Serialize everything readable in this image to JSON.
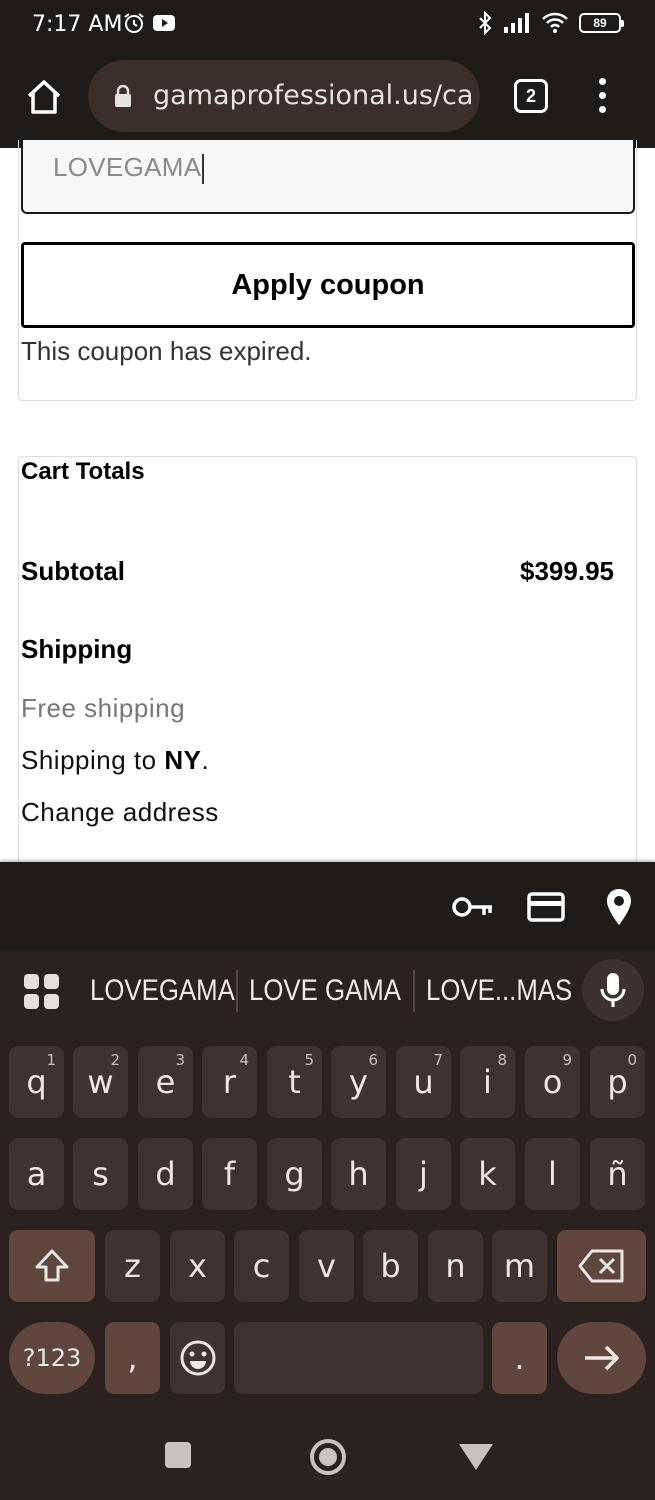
{
  "status_bar": {
    "time": "7:17 AM",
    "battery": "89",
    "icons": [
      "alarm-icon",
      "youtube-icon",
      "bluetooth-icon",
      "signal-icon",
      "wifi-icon",
      "battery-icon"
    ]
  },
  "browser": {
    "url": "gamaprofessional.us/ca",
    "tab_count": "2",
    "icons": [
      "home-icon",
      "lock-icon",
      "more-vert-icon"
    ]
  },
  "coupon": {
    "input_value": "LOVEGAMA",
    "apply_button": "Apply coupon",
    "message": "This coupon has expired."
  },
  "cart_totals": {
    "title": "Cart Totals",
    "subtotal_label": "Subtotal",
    "subtotal_value": "$399.95",
    "shipping_label": "Shipping",
    "shipping_method": "Free shipping",
    "shipping_to_prefix": "Shipping to ",
    "shipping_state": "NY",
    "shipping_to_suffix": ".",
    "change_address": "Change address"
  },
  "keyboard": {
    "autofill_icons": [
      "key-icon",
      "credit-card-icon",
      "location-pin-icon"
    ],
    "suggestions": [
      "LOVEGAMA",
      "LOVE GAMA",
      "LOVE...MAS"
    ],
    "row1": [
      {
        "k": "q",
        "n": "1"
      },
      {
        "k": "w",
        "n": "2"
      },
      {
        "k": "e",
        "n": "3"
      },
      {
        "k": "r",
        "n": "4"
      },
      {
        "k": "t",
        "n": "5"
      },
      {
        "k": "y",
        "n": "6"
      },
      {
        "k": "u",
        "n": "7"
      },
      {
        "k": "i",
        "n": "8"
      },
      {
        "k": "o",
        "n": "9"
      },
      {
        "k": "p",
        "n": "0"
      }
    ],
    "row2": [
      "a",
      "s",
      "d",
      "f",
      "g",
      "h",
      "j",
      "k",
      "l",
      "ñ"
    ],
    "row3": [
      "z",
      "x",
      "c",
      "v",
      "b",
      "n",
      "m"
    ],
    "symbols_key": "?123",
    "comma_key": ",",
    "period_key": "."
  },
  "colors": {
    "system_bar": "#1f1b18",
    "keyboard_bg": "#2b211e",
    "key_bg": "#3e3330",
    "special_key_bg": "#5f463f",
    "url_bar_bg": "#3a2f2b"
  }
}
